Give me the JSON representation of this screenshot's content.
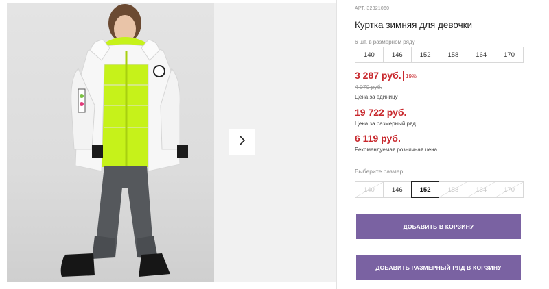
{
  "product": {
    "article": "АРТ. 32321060",
    "title": "Куртка зимняя для девочки"
  },
  "size_run": {
    "note": "6 шт. в размерном ряду",
    "sizes": [
      "140",
      "146",
      "152",
      "158",
      "164",
      "170"
    ]
  },
  "prices": {
    "unit_price": "3 287 руб.",
    "discount": "19%",
    "old_price": "4 070 руб.",
    "unit_label": "Цена за единицу",
    "run_price": "19 722 руб.",
    "run_label": "Цена за размерный ряд",
    "rrp_price": "6 119 руб.",
    "rrp_label": "Рекомендуемая розничная цена"
  },
  "size_picker": {
    "label": "Выберите размер:",
    "options": [
      {
        "size": "140",
        "state": "disabled"
      },
      {
        "size": "146",
        "state": "available"
      },
      {
        "size": "152",
        "state": "selected"
      },
      {
        "size": "158",
        "state": "disabled"
      },
      {
        "size": "164",
        "state": "disabled"
      },
      {
        "size": "170",
        "state": "disabled"
      }
    ]
  },
  "buttons": {
    "add_to_cart": "ДОБАВИТЬ В КОРЗИНУ",
    "add_run_to_cart": "ДОБАВИТЬ РАЗМЕРНЫЙ РЯД В КОРЗИНУ"
  },
  "gallery": {
    "next_icon": "chevron-right-icon"
  },
  "colors": {
    "price_red": "#c8282d",
    "button_purple": "#7a62a2",
    "jacket_accent": "#c6f21a"
  }
}
